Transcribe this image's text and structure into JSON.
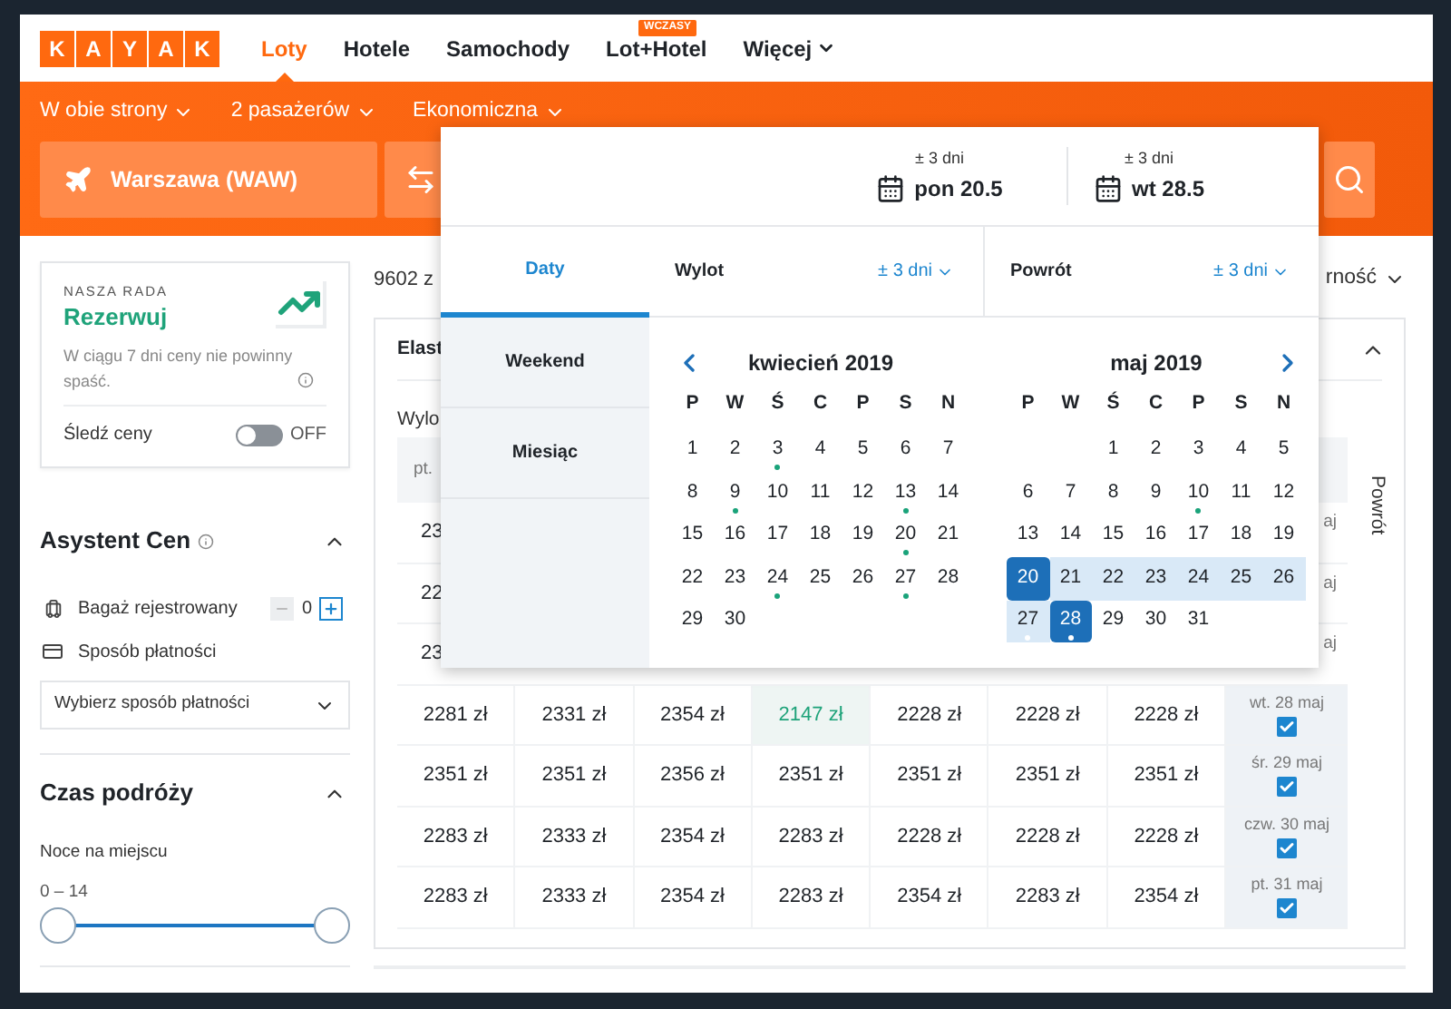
{
  "header": {
    "logo": [
      "K",
      "A",
      "Y",
      "A",
      "K"
    ],
    "nav": [
      {
        "label": "Loty",
        "selected": true,
        "dropdown": false
      },
      {
        "label": "Hotele",
        "selected": false,
        "dropdown": false
      },
      {
        "label": "Samochody",
        "selected": false,
        "dropdown": false
      },
      {
        "label": "Lot+Hotel",
        "selected": false,
        "dropdown": false,
        "badge": "WCZASY"
      },
      {
        "label": "Więcej",
        "selected": false,
        "dropdown": true
      }
    ]
  },
  "search_bar": {
    "options": [
      "W obie strony",
      "2 pasażerów",
      "Ekonomiczna"
    ],
    "origin": "Warszawa (WAW)"
  },
  "date_picker": {
    "fields": [
      {
        "flex": "± 3 dni",
        "date": "pon 20.5"
      },
      {
        "flex": "± 3 dni",
        "date": "wt 28.5"
      }
    ],
    "modes": [
      {
        "label": "Daty",
        "selected": true
      },
      {
        "label": "Weekend",
        "selected": false
      },
      {
        "label": "Miesiąc",
        "selected": false
      }
    ],
    "legs": [
      {
        "label": "Wylot",
        "flex": "± 3 dni"
      },
      {
        "label": "Powrót",
        "flex": "± 3 dni"
      }
    ],
    "months": [
      {
        "title": "kwiecień 2019",
        "prev_arrow": true,
        "next_arrow": false,
        "weekdays": [
          "P",
          "W",
          "Ś",
          "C",
          "P",
          "S",
          "N"
        ],
        "weeks": [
          [
            {
              "day": "1",
              "dot": false,
              "selected": false,
              "in_range": false
            },
            {
              "day": "2",
              "dot": false,
              "selected": false,
              "in_range": false
            },
            {
              "day": "3",
              "dot": true,
              "selected": false,
              "in_range": false
            },
            {
              "day": "4",
              "dot": false,
              "selected": false,
              "in_range": false
            },
            {
              "day": "5",
              "dot": false,
              "selected": false,
              "in_range": false
            },
            {
              "day": "6",
              "dot": false,
              "selected": false,
              "in_range": false
            },
            {
              "day": "7",
              "dot": false,
              "selected": false,
              "in_range": false
            }
          ],
          [
            {
              "day": "8",
              "dot": false,
              "selected": false,
              "in_range": false
            },
            {
              "day": "9",
              "dot": true,
              "selected": false,
              "in_range": false
            },
            {
              "day": "10",
              "dot": false,
              "selected": false,
              "in_range": false
            },
            {
              "day": "11",
              "dot": false,
              "selected": false,
              "in_range": false
            },
            {
              "day": "12",
              "dot": false,
              "selected": false,
              "in_range": false
            },
            {
              "day": "13",
              "dot": true,
              "selected": false,
              "in_range": false
            },
            {
              "day": "14",
              "dot": false,
              "selected": false,
              "in_range": false
            }
          ],
          [
            {
              "day": "15",
              "dot": false,
              "selected": false,
              "in_range": false
            },
            {
              "day": "16",
              "dot": false,
              "selected": false,
              "in_range": false
            },
            {
              "day": "17",
              "dot": false,
              "selected": false,
              "in_range": false
            },
            {
              "day": "18",
              "dot": false,
              "selected": false,
              "in_range": false
            },
            {
              "day": "19",
              "dot": false,
              "selected": false,
              "in_range": false
            },
            {
              "day": "20",
              "dot": true,
              "selected": false,
              "in_range": false
            },
            {
              "day": "21",
              "dot": false,
              "selected": false,
              "in_range": false
            }
          ],
          [
            {
              "day": "22",
              "dot": false,
              "selected": false,
              "in_range": false
            },
            {
              "day": "23",
              "dot": false,
              "selected": false,
              "in_range": false
            },
            {
              "day": "24",
              "dot": true,
              "selected": false,
              "in_range": false
            },
            {
              "day": "25",
              "dot": false,
              "selected": false,
              "in_range": false
            },
            {
              "day": "26",
              "dot": false,
              "selected": false,
              "in_range": false
            },
            {
              "day": "27",
              "dot": true,
              "selected": false,
              "in_range": false
            },
            {
              "day": "28",
              "dot": false,
              "selected": false,
              "in_range": false
            }
          ],
          [
            {
              "day": "29",
              "dot": false,
              "selected": false,
              "in_range": false
            },
            {
              "day": "30",
              "dot": false,
              "selected": false,
              "in_range": false
            }
          ]
        ]
      },
      {
        "title": "maj 2019",
        "prev_arrow": false,
        "next_arrow": true,
        "weekdays": [
          "P",
          "W",
          "Ś",
          "C",
          "P",
          "S",
          "N"
        ],
        "weeks": [
          [
            {
              "day": "1",
              "dot": false,
              "selected": false,
              "in_range": false
            },
            {
              "day": "2",
              "dot": false,
              "selected": false,
              "in_range": false
            },
            {
              "day": "3",
              "dot": false,
              "selected": false,
              "in_range": false
            },
            {
              "day": "4",
              "dot": false,
              "selected": false,
              "in_range": false
            },
            {
              "day": "5",
              "dot": false,
              "selected": false,
              "in_range": false
            }
          ],
          [
            {
              "day": "6",
              "dot": false,
              "selected": false,
              "in_range": false
            },
            {
              "day": "7",
              "dot": false,
              "selected": false,
              "in_range": false
            },
            {
              "day": "8",
              "dot": false,
              "selected": false,
              "in_range": false
            },
            {
              "day": "9",
              "dot": false,
              "selected": false,
              "in_range": false
            },
            {
              "day": "10",
              "dot": true,
              "selected": false,
              "in_range": false
            },
            {
              "day": "11",
              "dot": false,
              "selected": false,
              "in_range": false
            },
            {
              "day": "12",
              "dot": false,
              "selected": false,
              "in_range": false
            }
          ],
          [
            {
              "day": "13",
              "dot": false,
              "selected": false,
              "in_range": false
            },
            {
              "day": "14",
              "dot": false,
              "selected": false,
              "in_range": false
            },
            {
              "day": "15",
              "dot": false,
              "selected": false,
              "in_range": false
            },
            {
              "day": "16",
              "dot": false,
              "selected": false,
              "in_range": false
            },
            {
              "day": "17",
              "dot": false,
              "selected": false,
              "in_range": false
            },
            {
              "day": "18",
              "dot": false,
              "selected": false,
              "in_range": false
            },
            {
              "day": "19",
              "dot": false,
              "selected": false,
              "in_range": false
            }
          ],
          [
            {
              "day": "20",
              "dot": false,
              "selected": true,
              "in_range": false
            },
            {
              "day": "21",
              "dot": false,
              "selected": false,
              "in_range": true
            },
            {
              "day": "22",
              "dot": false,
              "selected": false,
              "in_range": true
            },
            {
              "day": "23",
              "dot": false,
              "selected": false,
              "in_range": true
            },
            {
              "day": "24",
              "dot": false,
              "selected": false,
              "in_range": true
            },
            {
              "day": "25",
              "dot": false,
              "selected": false,
              "in_range": true
            },
            {
              "day": "26",
              "dot": false,
              "selected": false,
              "in_range": true
            }
          ],
          [
            {
              "day": "27",
              "dot": true,
              "selected": false,
              "in_range": true
            },
            {
              "day": "28",
              "dot": true,
              "selected": true,
              "in_range": false
            },
            {
              "day": "29",
              "dot": false,
              "selected": false,
              "in_range": false
            },
            {
              "day": "30",
              "dot": false,
              "selected": false,
              "in_range": false
            },
            {
              "day": "31",
              "dot": false,
              "selected": false,
              "in_range": false
            }
          ]
        ]
      }
    ]
  },
  "deal_advice": {
    "eyebrow": "NASZA RADA",
    "verdict": "Rezerwuj",
    "text": "W ciągu 7 dni ceny nie powinny spaść.",
    "track_label": "Śledź ceny",
    "track_on": false,
    "track_state": "OFF"
  },
  "price_assistant": {
    "title": "Asystent Cen",
    "expanded": true,
    "baggage_label": "Bagaż rejestrowany",
    "baggage_count": "0",
    "payment_label": "Sposób płatności",
    "payment_placeholder": "Wybierz sposób płatności"
  },
  "trip_duration": {
    "title": "Czas podróży",
    "expanded": true,
    "label": "Noce na miejscu",
    "range": "0 – 14",
    "handles": [
      {
        "level": 0
      },
      {
        "level": 1
      }
    ]
  },
  "results": {
    "count": "9602 z",
    "sort": "rność",
    "card_title": "Elast",
    "card_expanded": true,
    "axis_label": "Wylo",
    "column_header": "pt.",
    "side_label": "Powrót",
    "rows": [
      {
        "kind": "partial",
        "first": "23",
        "date": "aj"
      },
      {
        "kind": "partial",
        "first": "22",
        "date": "aj"
      },
      {
        "kind": "partial",
        "first": "23",
        "date": "aj"
      },
      {
        "kind": "full",
        "date": "wt. 28 maj",
        "checked": true,
        "cells": [
          {
            "price": "2281 zł",
            "best": false
          },
          {
            "price": "2331 zł",
            "best": false
          },
          {
            "price": "2354 zł",
            "best": false
          },
          {
            "price": "2147 zł",
            "best": true
          },
          {
            "price": "2228 zł",
            "best": false
          },
          {
            "price": "2228 zł",
            "best": false
          },
          {
            "price": "2228 zł",
            "best": false
          }
        ]
      },
      {
        "kind": "full",
        "date": "śr. 29 maj",
        "checked": true,
        "cells": [
          {
            "price": "2351 zł",
            "best": false
          },
          {
            "price": "2351 zł",
            "best": false
          },
          {
            "price": "2356 zł",
            "best": false
          },
          {
            "price": "2351 zł",
            "best": false
          },
          {
            "price": "2351 zł",
            "best": false
          },
          {
            "price": "2351 zł",
            "best": false
          },
          {
            "price": "2351 zł",
            "best": false
          }
        ]
      },
      {
        "kind": "full",
        "date": "czw. 30 maj",
        "checked": true,
        "cells": [
          {
            "price": "2283 zł",
            "best": false
          },
          {
            "price": "2333 zł",
            "best": false
          },
          {
            "price": "2354 zł",
            "best": false
          },
          {
            "price": "2283 zł",
            "best": false
          },
          {
            "price": "2228 zł",
            "best": false
          },
          {
            "price": "2228 zł",
            "best": false
          },
          {
            "price": "2228 zł",
            "best": false
          }
        ]
      },
      {
        "kind": "full",
        "date": "pt. 31 maj",
        "checked": true,
        "cells": [
          {
            "price": "2283 zł",
            "best": false
          },
          {
            "price": "2333 zł",
            "best": false
          },
          {
            "price": "2354 zł",
            "best": false
          },
          {
            "price": "2283 zł",
            "best": false
          },
          {
            "price": "2354 zł",
            "best": false
          },
          {
            "price": "2283 zł",
            "best": false
          },
          {
            "price": "2354 zł",
            "best": false
          }
        ]
      }
    ]
  }
}
